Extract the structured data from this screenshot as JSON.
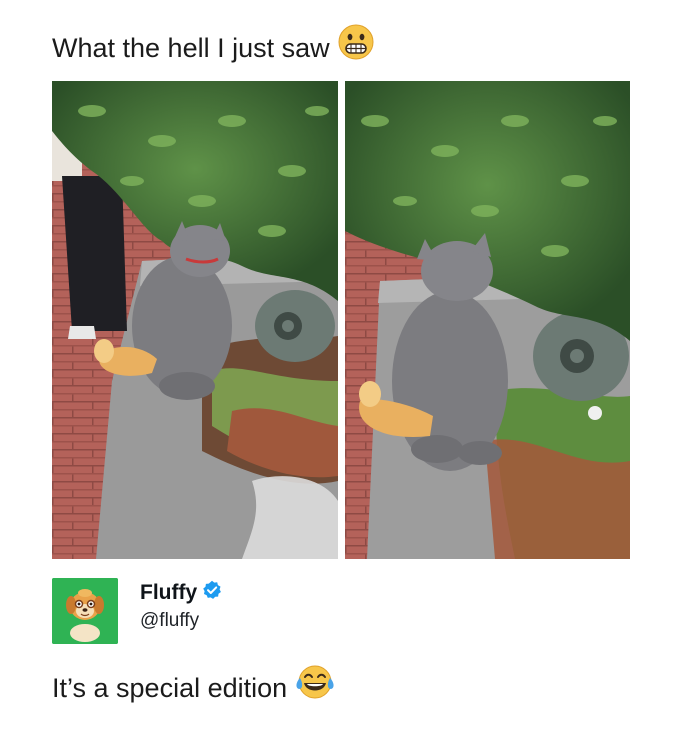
{
  "post": {
    "headline": "What the hell I just saw",
    "headline_emoji": "grimacing-face-emoji",
    "author": {
      "display_name": "Fluffy",
      "handle": "@fluffy",
      "verified": true,
      "avatar_icon": "cartoon-dog-avatar"
    },
    "caption": "It’s a special edition",
    "caption_emoji": "tears-of-joy-emoji"
  },
  "colors": {
    "avatar_bg": "#2fb354",
    "verified_badge": "#1d9bf0",
    "cat_fur": "#7c7c80",
    "cat_tail": "#e9b060",
    "brick": "#b4625a",
    "foliage": "#3c6d35"
  }
}
